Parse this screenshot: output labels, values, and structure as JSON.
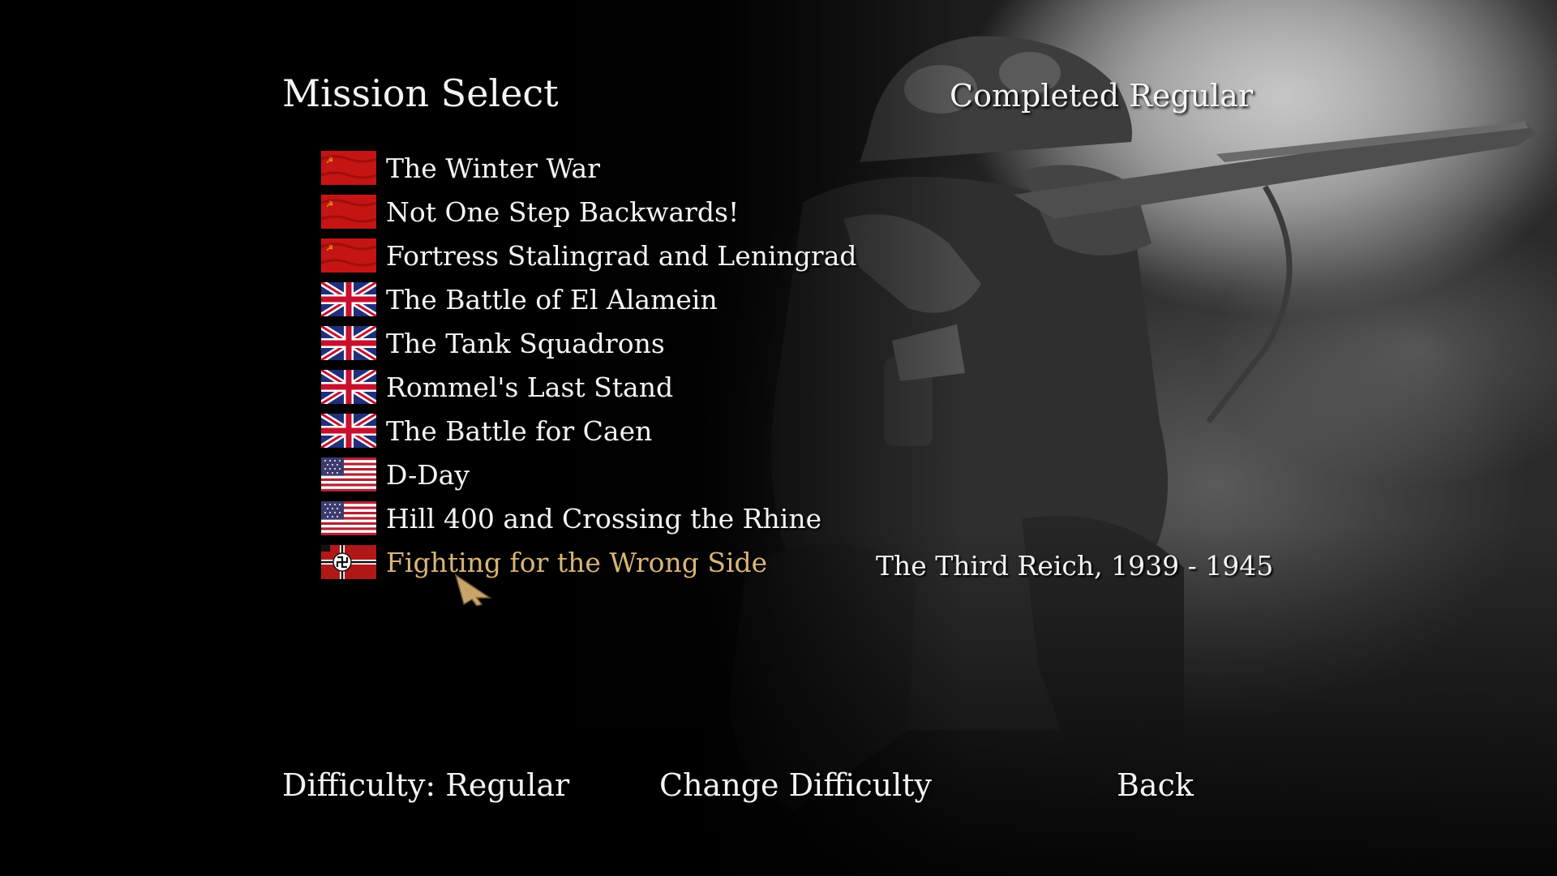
{
  "screen": {
    "title": "Mission Select",
    "status": "Completed Regular"
  },
  "missions": [
    {
      "label": "The Winter War",
      "flag": "soviet-flag"
    },
    {
      "label": "Not One Step Backwards!",
      "flag": "soviet-flag"
    },
    {
      "label": "Fortress Stalingrad and Leningrad",
      "flag": "soviet-flag"
    },
    {
      "label": "The Battle of El Alamein",
      "flag": "union-jack-flag"
    },
    {
      "label": "The Tank Squadrons",
      "flag": "union-jack-flag"
    },
    {
      "label": "Rommel's Last Stand",
      "flag": "union-jack-flag"
    },
    {
      "label": "The Battle for Caen",
      "flag": "union-jack-flag"
    },
    {
      "label": "D-Day",
      "flag": "us-flag"
    },
    {
      "label": "Hill 400 and Crossing the Rhine",
      "flag": "us-flag"
    },
    {
      "label": "Fighting for the Wrong Side",
      "flag": "german-war-flag",
      "selected": true
    }
  ],
  "selected_mission": {
    "description": "The Third Reich, 1939 - 1945"
  },
  "footer": {
    "difficulty": "Difficulty: Regular",
    "change_difficulty": "Change Difficulty",
    "back": "Back"
  },
  "colors": {
    "text": "#f4f4f4",
    "selected": "#d9b577",
    "background": "#000000"
  }
}
